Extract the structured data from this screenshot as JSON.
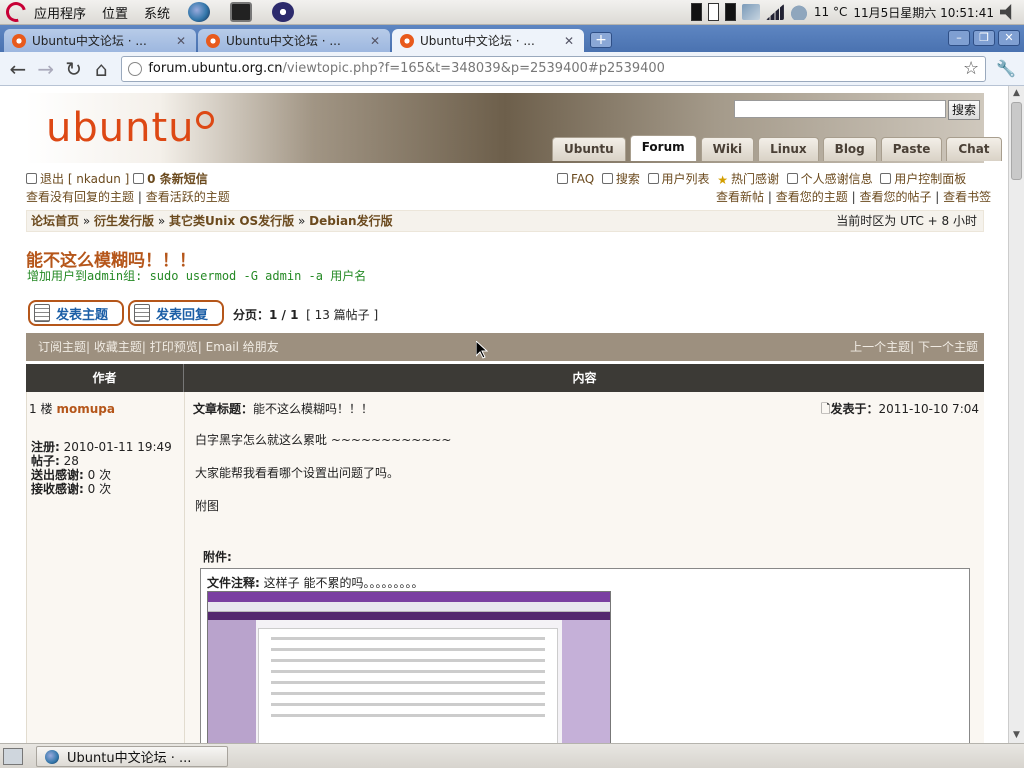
{
  "panel": {
    "menus": [
      "应用程序",
      "位置",
      "系统"
    ],
    "temperature": "11 °C",
    "clock": "11月5日星期六  10:51:41"
  },
  "browser": {
    "tabs": [
      {
        "title": "Ubuntu中文论坛 · ..."
      },
      {
        "title": "Ubuntu中文论坛 · ..."
      },
      {
        "title": "Ubuntu中文论坛 · ..."
      }
    ],
    "url_host": "forum.ubuntu.org.cn",
    "url_path": "/viewtopic.php?f=165&t=348039&p=2539400#p2539400"
  },
  "site": {
    "logo_text": "ubuntu",
    "search_button": "搜索",
    "nav_tabs": [
      "Ubuntu",
      "Forum",
      "Wiki",
      "Linux",
      "Blog",
      "Paste",
      "Chat"
    ],
    "active_nav": "Forum"
  },
  "user_links": {
    "logout": "退出 [ nkadun ]",
    "messages": "0 条新短信",
    "no_reply": "查看没有回复的主题",
    "active": "查看活跃的主题",
    "faq": "FAQ",
    "search": "搜索",
    "members": "用户列表",
    "hot_thanks": "热门感谢",
    "my_thanks": "个人感谢信息",
    "ucp": "用户控制面板",
    "new_posts": "查看新帖",
    "your_topics": "查看您的主题",
    "your_posts": "查看您的帖子",
    "bookmarks": "查看书签"
  },
  "breadcrumb": {
    "items": [
      "论坛首页",
      "衍生发行版",
      "其它类Unix OS发行版",
      "Debian发行版"
    ],
    "timezone": "当前时区为 UTC + 8 小时"
  },
  "topic": {
    "title": "能不这么模糊吗！！！",
    "signature": "增加用户到admin组: sudo usermod -G admin -a 用户名",
    "new_topic_btn": "发表主题",
    "reply_btn": "发表回复",
    "pagination_label": "分页：",
    "pagination_value": "1 / 1",
    "post_count": "[ 13 篇帖子 ]",
    "subscribe": "订阅主题",
    "bookmark": "收藏主题",
    "print": "打印预览",
    "email": "Email 给朋友",
    "prev": "上一个主题",
    "next": "下一个主题"
  },
  "table": {
    "author_header": "作者",
    "content_header": "内容"
  },
  "post": {
    "floor": "1 楼",
    "author": "momupa",
    "reg_label": "注册:",
    "reg_value": "2010-01-11 19:49",
    "posts_label": "帖子:",
    "posts_value": "28",
    "thanks_sent_label": "送出感谢:",
    "thanks_sent_value": "0 次",
    "thanks_recv_label": "接收感谢:",
    "thanks_recv_value": "0 次",
    "subject_label": "文章标题：",
    "subject": "能不这么模糊吗！！！",
    "posted_label": "发表于：",
    "posted": "2011-10-10 7:04",
    "lines": [
      "白字黑字怎么就这么累吡 ~~~~~~~~~~~~",
      "大家能帮我看看哪个设置出问题了吗。",
      "附图"
    ],
    "attachment_label": "附件:",
    "file_comment_label": "文件注释:",
    "file_comment": "这样子 能不累的吗。。。。。。。。。"
  },
  "taskbar": {
    "item": "Ubuntu中文论坛 · ..."
  }
}
